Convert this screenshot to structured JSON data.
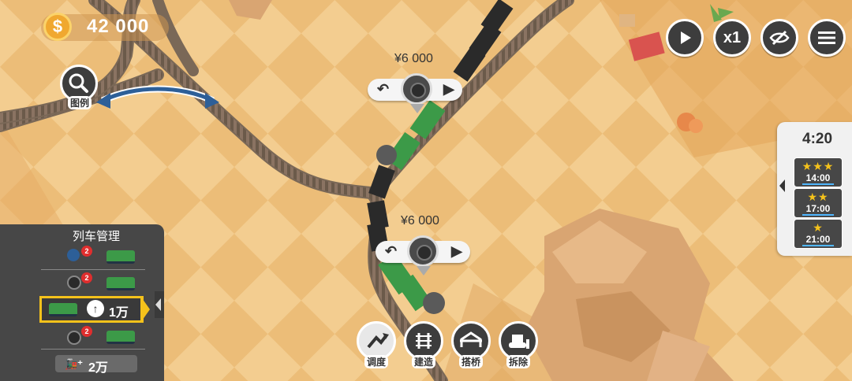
{
  "hud": {
    "money": "42 000",
    "coin_symbol": "$",
    "search_label": "图例",
    "speed_label": "x1"
  },
  "trains": [
    {
      "price": "¥6 000"
    },
    {
      "price": "¥6 000"
    }
  ],
  "timer": {
    "time": "4:20",
    "goals": [
      {
        "stars": "★★★",
        "time": "14:00"
      },
      {
        "stars": "★★",
        "time": "17:00"
      },
      {
        "stars": "★",
        "time": "21:00"
      }
    ]
  },
  "train_panel": {
    "title": "列车管理",
    "rows": [
      {
        "badge": "2"
      },
      {
        "badge": "2"
      },
      {
        "cost": "1万"
      },
      {
        "badge": "2"
      }
    ],
    "buy_cost": "2万"
  },
  "tools": [
    {
      "label": "调度"
    },
    {
      "label": "建造"
    },
    {
      "label": "搭桥"
    },
    {
      "label": "拆除"
    }
  ],
  "colors": {
    "sand_light": "#f0c88a",
    "sand_dark": "#e3a85c",
    "track": "#5a5047",
    "accent_yellow": "#f5c21b",
    "button_dark": "#3d3d3d",
    "train_green": "#3c9a48"
  }
}
